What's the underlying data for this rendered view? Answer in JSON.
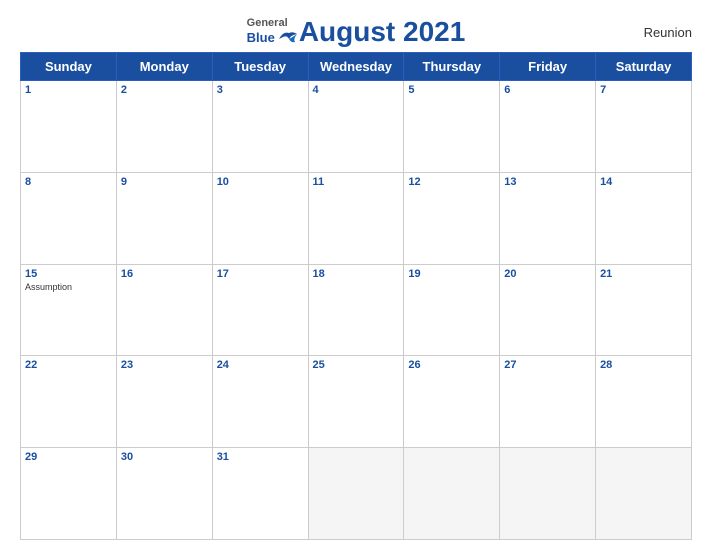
{
  "header": {
    "logo": {
      "general": "General",
      "blue": "Blue",
      "bird_color": "#1a4fa0"
    },
    "title": "August 2021",
    "region": "Reunion"
  },
  "weekdays": [
    "Sunday",
    "Monday",
    "Tuesday",
    "Wednesday",
    "Thursday",
    "Friday",
    "Saturday"
  ],
  "weeks": [
    [
      {
        "day": 1,
        "holiday": ""
      },
      {
        "day": 2,
        "holiday": ""
      },
      {
        "day": 3,
        "holiday": ""
      },
      {
        "day": 4,
        "holiday": ""
      },
      {
        "day": 5,
        "holiday": ""
      },
      {
        "day": 6,
        "holiday": ""
      },
      {
        "day": 7,
        "holiday": ""
      }
    ],
    [
      {
        "day": 8,
        "holiday": ""
      },
      {
        "day": 9,
        "holiday": ""
      },
      {
        "day": 10,
        "holiday": ""
      },
      {
        "day": 11,
        "holiday": ""
      },
      {
        "day": 12,
        "holiday": ""
      },
      {
        "day": 13,
        "holiday": ""
      },
      {
        "day": 14,
        "holiday": ""
      }
    ],
    [
      {
        "day": 15,
        "holiday": "Assumption"
      },
      {
        "day": 16,
        "holiday": ""
      },
      {
        "day": 17,
        "holiday": ""
      },
      {
        "day": 18,
        "holiday": ""
      },
      {
        "day": 19,
        "holiday": ""
      },
      {
        "day": 20,
        "holiday": ""
      },
      {
        "day": 21,
        "holiday": ""
      }
    ],
    [
      {
        "day": 22,
        "holiday": ""
      },
      {
        "day": 23,
        "holiday": ""
      },
      {
        "day": 24,
        "holiday": ""
      },
      {
        "day": 25,
        "holiday": ""
      },
      {
        "day": 26,
        "holiday": ""
      },
      {
        "day": 27,
        "holiday": ""
      },
      {
        "day": 28,
        "holiday": ""
      }
    ],
    [
      {
        "day": 29,
        "holiday": ""
      },
      {
        "day": 30,
        "holiday": ""
      },
      {
        "day": 31,
        "holiday": ""
      },
      {
        "day": null,
        "holiday": ""
      },
      {
        "day": null,
        "holiday": ""
      },
      {
        "day": null,
        "holiday": ""
      },
      {
        "day": null,
        "holiday": ""
      }
    ]
  ],
  "colors": {
    "header_bg": "#1a4fa0",
    "row_header_bg": "#c8d8f0",
    "text_day": "#1a4fa0",
    "border": "#b0b8cc"
  }
}
